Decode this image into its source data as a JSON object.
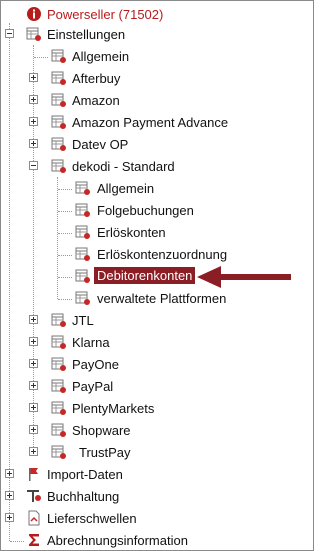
{
  "tree": {
    "root_powerseller": "Powerseller (71502)",
    "einstellungen": "Einstellungen",
    "items_level2": [
      "Allgemein",
      "Afterbuy",
      "Amazon",
      "Amazon Payment Advance",
      "Datev OP",
      "dekodi - Standard"
    ],
    "dekodi_children": [
      "Allgemein",
      "Folgebuchungen",
      "Erlöskonten",
      "Erlöskontenzuordnung",
      "Debitorenkonten",
      "verwaltete Plattformen"
    ],
    "items_level2_after": [
      "JTL",
      "Klarna",
      "PayOne",
      "PayPal",
      "PlentyMarkets",
      "Shopware",
      "TrustPay"
    ],
    "import_daten": "Import-Daten",
    "buchhaltung": "Buchhaltung",
    "lieferschwellen": "Lieferschwellen",
    "abrechnungsinformation": "Abrechnungsinformation"
  },
  "colors": {
    "selection": "#8b1e24",
    "arrow": "#8b1e24",
    "powerseller": "#b71c1c"
  },
  "icons": {
    "powerseller": "info-icon",
    "settings": "settings-table-icon",
    "import": "import-flag-icon",
    "buchhaltung": "accounting-icon",
    "lieferschwellen": "document-icon",
    "abrechnung": "sigma-icon"
  }
}
